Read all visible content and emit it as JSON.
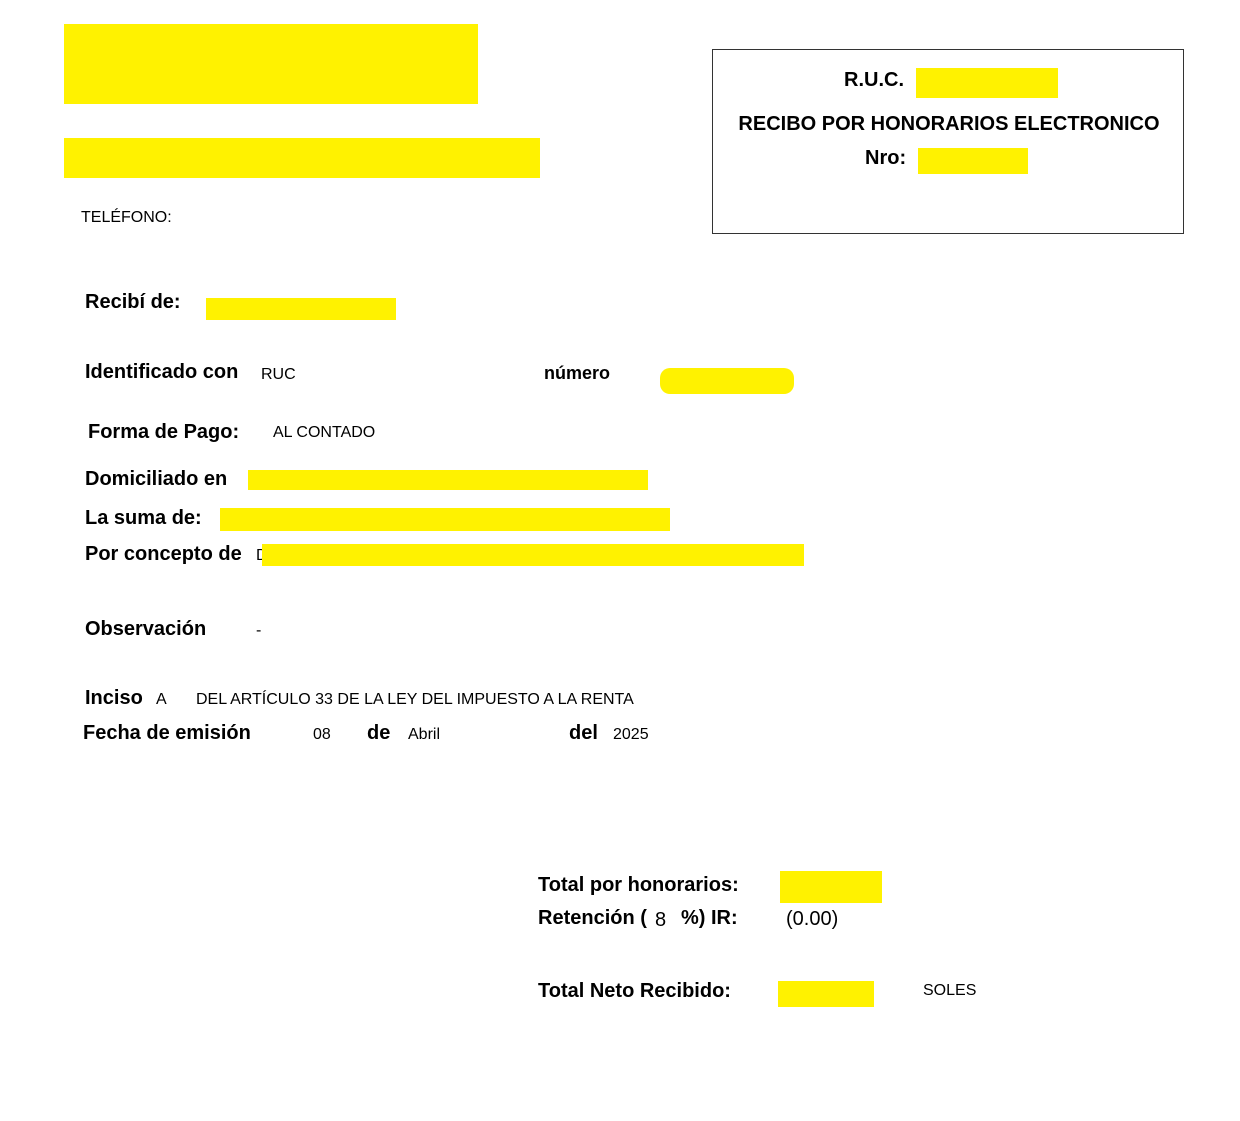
{
  "header": {
    "telefono_label": "TELÉFONO:"
  },
  "receipt_box": {
    "ruc_label": "R.U.C.",
    "title": "RECIBO POR HONORARIOS ELECTRONICO",
    "nro_label": "Nro:"
  },
  "fields": {
    "recibi_label": "Recibí de:",
    "identificado_label": "Identificado con",
    "identificado_value": "RUC",
    "numero_label": "número",
    "forma_pago_label": "Forma de Pago:",
    "forma_pago_value": "AL CONTADO",
    "domiciliado_label": "Domiciliado en",
    "suma_label": "La suma de:",
    "concepto_label": "Por concepto de",
    "concepto_visible_char": "D",
    "observacion_label": "Observación",
    "observacion_value": "-",
    "inciso_label": "Inciso",
    "inciso_value": "A",
    "inciso_text": "DEL ARTÍCULO 33 DE LA LEY DEL IMPUESTO A LA RENTA",
    "fecha_label": "Fecha de emisión",
    "fecha_day": "08",
    "fecha_de_label": "de",
    "fecha_month": "Abril",
    "fecha_del_label": "del",
    "fecha_year": "2025"
  },
  "totals": {
    "total_honorarios_label": "Total por honorarios:",
    "retencion_label_pre": "Retención (",
    "retencion_pct": "8",
    "retencion_label_post": "%) IR:",
    "retencion_value": "(0.00)",
    "total_neto_label": "Total Neto Recibido:",
    "currency": "SOLES"
  },
  "colors": {
    "redaction": "#fff200",
    "border": "#333333"
  }
}
